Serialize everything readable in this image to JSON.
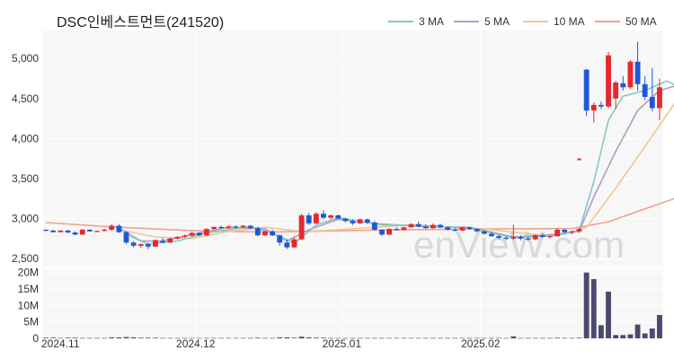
{
  "chart_data": {
    "type": "candlestick",
    "title": "DSC인베스트먼트(241520)",
    "watermark": "enVieW.com",
    "x_labels": [
      "2024.11",
      "2024.12",
      "2025.01",
      "2025.02"
    ],
    "price_ticks": [
      "2,500",
      "3,000",
      "3,500",
      "4,000",
      "4,500",
      "5,000"
    ],
    "price_tick_values": [
      2500,
      3000,
      3500,
      4000,
      4500,
      5000
    ],
    "price_ylim": [
      2400,
      5350
    ],
    "volume_ticks": [
      "0",
      "5M",
      "10M",
      "15M",
      "20M"
    ],
    "volume_tick_values": [
      0,
      5,
      10,
      15,
      20
    ],
    "volume_ylim": [
      0,
      21
    ],
    "volume_unit": "M",
    "colors": {
      "up": "#e8272f",
      "down": "#1f58d6",
      "volume": "#4b4a6e",
      "ma3": "#7fcac3",
      "ma5": "#b19cc7",
      "ma10": "#f2c68d",
      "ma50": "#f0a28e"
    },
    "legend": [
      {
        "name": "3 MA",
        "color": "#7fcac3"
      },
      {
        "name": "5 MA",
        "color": "#b19cc7"
      },
      {
        "name": "10 MA",
        "color": "#f2c68d"
      },
      {
        "name": "50 MA",
        "color": "#f0a28e"
      }
    ],
    "candles": [
      [
        2860,
        2865,
        2840,
        2850
      ],
      [
        2850,
        2858,
        2825,
        2830
      ],
      [
        2830,
        2855,
        2825,
        2850
      ],
      [
        2850,
        2860,
        2820,
        2825
      ],
      [
        2825,
        2840,
        2790,
        2800
      ],
      [
        2800,
        2870,
        2795,
        2860
      ],
      [
        2860,
        2868,
        2835,
        2840
      ],
      [
        2840,
        2850,
        2830,
        2845
      ],
      [
        2845,
        2875,
        2840,
        2860
      ],
      [
        2860,
        2930,
        2845,
        2910
      ],
      [
        2910,
        2930,
        2820,
        2830
      ],
      [
        2830,
        2845,
        2680,
        2700
      ],
      [
        2700,
        2715,
        2640,
        2660
      ],
      [
        2660,
        2690,
        2630,
        2680
      ],
      [
        2680,
        2700,
        2620,
        2650
      ],
      [
        2650,
        2740,
        2645,
        2730
      ],
      [
        2720,
        2760,
        2690,
        2700
      ],
      [
        2700,
        2760,
        2695,
        2750
      ],
      [
        2750,
        2780,
        2740,
        2770
      ],
      [
        2770,
        2800,
        2760,
        2785
      ],
      [
        2785,
        2840,
        2780,
        2820
      ],
      [
        2820,
        2830,
        2780,
        2790
      ],
      [
        2790,
        2880,
        2785,
        2870
      ],
      [
        2870,
        2900,
        2860,
        2895
      ],
      [
        2895,
        2910,
        2870,
        2880
      ],
      [
        2880,
        2920,
        2870,
        2900
      ],
      [
        2900,
        2915,
        2875,
        2890
      ],
      [
        2890,
        2920,
        2880,
        2910
      ],
      [
        2910,
        2920,
        2870,
        2880
      ],
      [
        2880,
        2900,
        2780,
        2790
      ],
      [
        2790,
        2850,
        2780,
        2840
      ],
      [
        2840,
        2860,
        2780,
        2790
      ],
      [
        2790,
        2800,
        2660,
        2700
      ],
      [
        2700,
        2740,
        2620,
        2640
      ],
      [
        2640,
        2760,
        2630,
        2740
      ],
      [
        2740,
        3060,
        2730,
        3040
      ],
      [
        3040,
        3070,
        2920,
        2940
      ],
      [
        2940,
        3080,
        2930,
        3060
      ],
      [
        3060,
        3100,
        2990,
        3010
      ],
      [
        3010,
        3050,
        2990,
        3040
      ],
      [
        3040,
        3050,
        2990,
        3000
      ],
      [
        3000,
        3010,
        2950,
        2970
      ],
      [
        2970,
        2990,
        2920,
        2940
      ],
      [
        2940,
        3000,
        2930,
        2990
      ],
      [
        2990,
        3000,
        2930,
        2950
      ],
      [
        2950,
        2970,
        2850,
        2860
      ],
      [
        2860,
        2870,
        2780,
        2800
      ],
      [
        2800,
        2880,
        2790,
        2870
      ],
      [
        2870,
        2890,
        2850,
        2860
      ],
      [
        2860,
        2900,
        2850,
        2890
      ],
      [
        2890,
        2940,
        2885,
        2930
      ],
      [
        2930,
        2960,
        2890,
        2900
      ],
      [
        2900,
        2930,
        2870,
        2880
      ],
      [
        2880,
        2940,
        2870,
        2920
      ],
      [
        2920,
        2935,
        2880,
        2890
      ],
      [
        2890,
        2900,
        2850,
        2860
      ],
      [
        2860,
        2880,
        2840,
        2850
      ],
      [
        2850,
        2900,
        2845,
        2890
      ],
      [
        2890,
        2900,
        2860,
        2870
      ],
      [
        2870,
        2880,
        2830,
        2840
      ],
      [
        2840,
        2850,
        2800,
        2810
      ],
      [
        2810,
        2830,
        2770,
        2780
      ],
      [
        2780,
        2800,
        2740,
        2760
      ],
      [
        2760,
        2780,
        2730,
        2750
      ],
      [
        2750,
        2920,
        2730,
        2770
      ],
      [
        2770,
        2790,
        2730,
        2750
      ],
      [
        2750,
        2770,
        2720,
        2740
      ],
      [
        2740,
        2800,
        2730,
        2790
      ],
      [
        2790,
        2810,
        2760,
        2770
      ],
      [
        2770,
        2790,
        2750,
        2780
      ],
      [
        2780,
        2880,
        2770,
        2860
      ],
      [
        2860,
        2870,
        2810,
        2830
      ],
      [
        2830,
        2850,
        2800,
        2840
      ],
      [
        2840,
        2880,
        2820,
        2870
      ],
      [
        4860,
        4870,
        4280,
        4350
      ],
      [
        4350,
        4450,
        4200,
        4420
      ],
      [
        4420,
        4460,
        4370,
        4400
      ],
      [
        4400,
        5080,
        4380,
        5040
      ],
      [
        4500,
        4720,
        4370,
        4700
      ],
      [
        4690,
        4780,
        4600,
        4640
      ],
      [
        4640,
        4980,
        4620,
        4960
      ],
      [
        4960,
        5210,
        4600,
        4680
      ],
      [
        4680,
        4780,
        4480,
        4520
      ],
      [
        4520,
        4880,
        4340,
        4380
      ],
      [
        4380,
        4750,
        4230,
        4640
      ]
    ],
    "volumes_M": [
      0.2,
      0.2,
      0.1,
      0.2,
      0.2,
      0.1,
      0.1,
      0.1,
      0.1,
      0.3,
      0.3,
      0.4,
      0.3,
      0.2,
      0.2,
      0.2,
      0.1,
      0.1,
      0.1,
      0.1,
      0.1,
      0.1,
      0.1,
      0.1,
      0.1,
      0.1,
      0.1,
      0.1,
      0.1,
      0.2,
      0.1,
      0.1,
      0.3,
      0.3,
      0.2,
      0.5,
      0.3,
      0.2,
      0.2,
      0.1,
      0.1,
      0.1,
      0.1,
      0.1,
      0.1,
      0.1,
      0.1,
      0.1,
      0.1,
      0.1,
      0.1,
      0.1,
      0.1,
      0.1,
      0.1,
      0.1,
      0.1,
      0.1,
      0.1,
      0.1,
      0.1,
      0.1,
      0.1,
      0.1,
      0.6,
      0.1,
      0.1,
      0.1,
      0.1,
      0.1,
      0.2,
      0.1,
      0.1,
      0.2,
      20.0,
      18.0,
      4.0,
      14.2,
      1.0,
      1.0,
      1.2,
      4.2,
      1.5,
      3.0,
      7.1
    ],
    "stray_mark": {
      "index": 73,
      "price": 3740
    },
    "ma": {
      "ma50": [
        [
          0,
          2950
        ],
        [
          10,
          2890
        ],
        [
          20,
          2850
        ],
        [
          30,
          2830
        ],
        [
          45,
          2855
        ],
        [
          60,
          2870
        ],
        [
          72,
          2875
        ],
        [
          77,
          2960
        ],
        [
          82,
          3120
        ],
        [
          87,
          3280
        ]
      ],
      "ma10": [
        [
          10,
          2860
        ],
        [
          15,
          2770
        ],
        [
          20,
          2750
        ],
        [
          25,
          2840
        ],
        [
          30,
          2890
        ],
        [
          35,
          2840
        ],
        [
          40,
          2860
        ],
        [
          50,
          2920
        ],
        [
          60,
          2870
        ],
        [
          68,
          2790
        ],
        [
          72,
          2830
        ],
        [
          74,
          2890
        ],
        [
          78,
          3380
        ],
        [
          82,
          3900
        ],
        [
          86,
          4430
        ],
        [
          88,
          4600
        ]
      ],
      "ma5": [
        [
          10,
          2880
        ],
        [
          13,
          2720
        ],
        [
          16,
          2720
        ],
        [
          20,
          2800
        ],
        [
          25,
          2890
        ],
        [
          30,
          2870
        ],
        [
          33,
          2720
        ],
        [
          36,
          2860
        ],
        [
          40,
          2990
        ],
        [
          46,
          2930
        ],
        [
          52,
          2900
        ],
        [
          58,
          2890
        ],
        [
          64,
          2770
        ],
        [
          70,
          2800
        ],
        [
          73,
          2840
        ],
        [
          75,
          3270
        ],
        [
          78,
          3840
        ],
        [
          81,
          4350
        ],
        [
          84,
          4600
        ],
        [
          87,
          4680
        ],
        [
          88,
          4650
        ]
      ],
      "ma3": [
        [
          10,
          2880
        ],
        [
          12,
          2760
        ],
        [
          14,
          2680
        ],
        [
          18,
          2720
        ],
        [
          22,
          2820
        ],
        [
          28,
          2900
        ],
        [
          31,
          2820
        ],
        [
          34,
          2690
        ],
        [
          37,
          2920
        ],
        [
          40,
          3010
        ],
        [
          46,
          2920
        ],
        [
          52,
          2910
        ],
        [
          58,
          2880
        ],
        [
          64,
          2760
        ],
        [
          70,
          2790
        ],
        [
          73,
          2850
        ],
        [
          75,
          3460
        ],
        [
          77,
          4230
        ],
        [
          79,
          4530
        ],
        [
          82,
          4600
        ],
        [
          85,
          4720
        ],
        [
          88,
          4580
        ]
      ]
    }
  }
}
